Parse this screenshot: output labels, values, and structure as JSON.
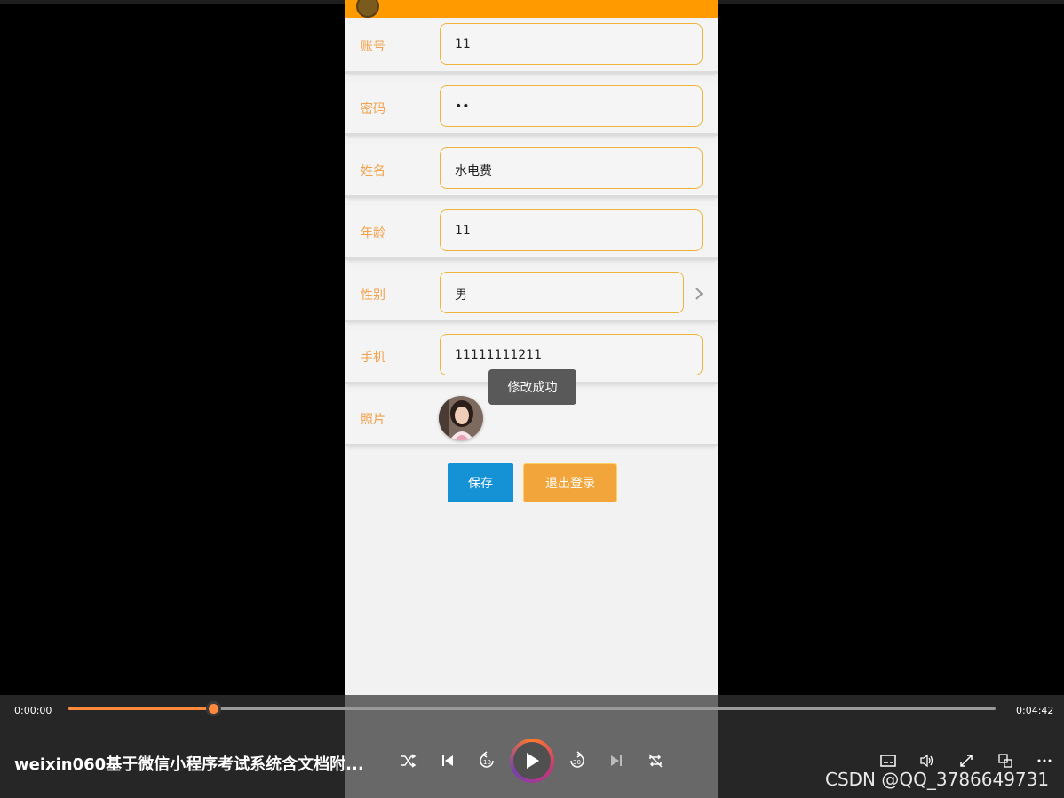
{
  "profile_form": {
    "rows": [
      {
        "label": "账号",
        "value": "11"
      },
      {
        "label": "密码",
        "value": "••"
      },
      {
        "label": "姓名",
        "value": "水电费"
      },
      {
        "label": "年龄",
        "value": "11"
      },
      {
        "label": "性别",
        "value": "男"
      },
      {
        "label": "手机",
        "value": "11111111211"
      }
    ],
    "photo_label": "照片",
    "save_label": "保存",
    "logout_label": "退出登录",
    "toast": "修改成功"
  },
  "player": {
    "current_time": "0:00:00",
    "total_time": "0:04:42",
    "progress_percent": 15.6,
    "title": "weixin060基于微信小程序考试系统含文档附...",
    "watermark": "CSDN @QQ_3786649731",
    "accent_color": "#ff8a3c"
  },
  "icons": [
    "shuffle-icon",
    "skip-previous-icon",
    "rewind-10-icon",
    "play-icon",
    "forward-30-icon",
    "skip-next-icon",
    "repeat-off-icon",
    "subtitles-icon",
    "volume-icon",
    "fullscreen-icon",
    "miniplayer-icon",
    "more-icon",
    "chevron-right-icon"
  ]
}
